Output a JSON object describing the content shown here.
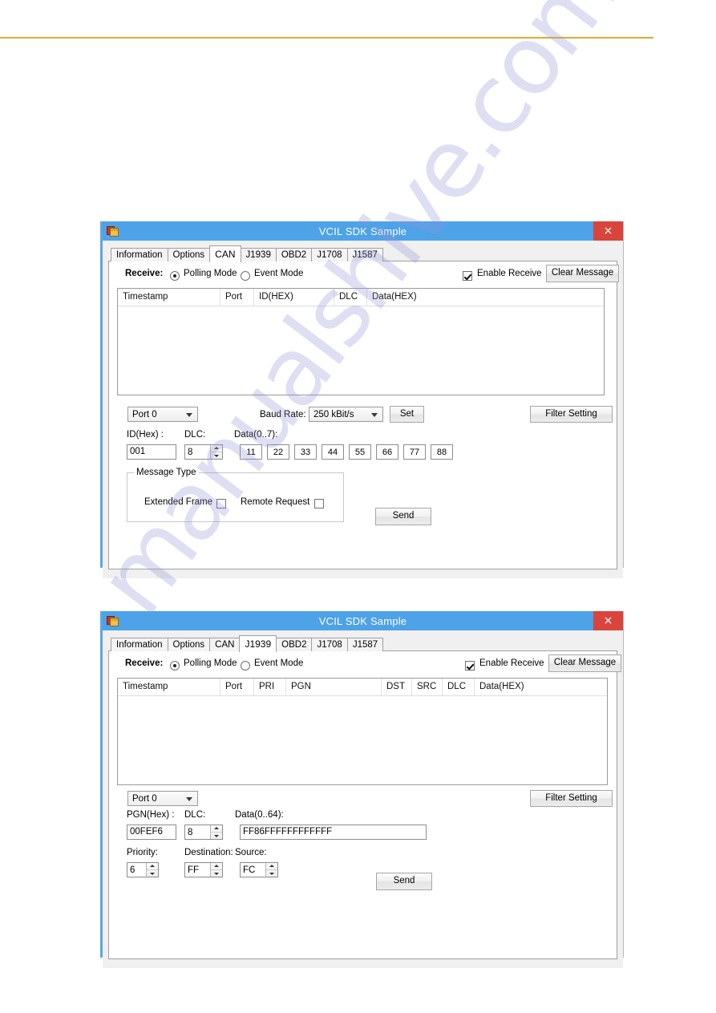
{
  "page": {
    "rule_color": "#d79a22",
    "watermark_text": "manualshive.com"
  },
  "windows": [
    {
      "id": "can",
      "title": "VCIL SDK Sample",
      "close_label": "×",
      "tabs": [
        {
          "label": "Information",
          "active": false
        },
        {
          "label": "Options",
          "active": false
        },
        {
          "label": "CAN",
          "active": true
        },
        {
          "label": "J1939",
          "active": false
        },
        {
          "label": "OBD2",
          "active": false
        },
        {
          "label": "J1708",
          "active": false
        },
        {
          "label": "J1587",
          "active": false
        }
      ],
      "receive": {
        "label": "Receive:",
        "polling_label": "Polling Mode",
        "polling_selected": true,
        "event_label": "Event Mode",
        "event_selected": false,
        "enable_receive_label": "Enable Receive",
        "enable_receive_checked": true,
        "clear_message_label": "Clear Message"
      },
      "list": {
        "columns": [
          "Timestamp",
          "Port",
          "ID(HEX)",
          "DLC",
          "Data(HEX)"
        ],
        "rows": []
      },
      "controls": {
        "port_value": "Port 0",
        "baud_label": "Baud Rate:",
        "baud_value": "250 kBit/s",
        "set_label": "Set",
        "filter_label": "Filter Setting",
        "id_label": "ID(Hex) :",
        "id_value": "001",
        "dlc_label": "DLC:",
        "dlc_value": "8",
        "data_label": "Data(0..7):",
        "data_values": [
          "11",
          "22",
          "33",
          "44",
          "55",
          "66",
          "77",
          "88"
        ],
        "msgtype_label": "Message Type",
        "extended_frame_label": "Extended Frame",
        "extended_frame_checked": false,
        "remote_request_label": "Remote Request",
        "remote_request_checked": false,
        "send_label": "Send"
      }
    },
    {
      "id": "j1939",
      "title": "VCIL SDK Sample",
      "close_label": "×",
      "tabs": [
        {
          "label": "Information",
          "active": false
        },
        {
          "label": "Options",
          "active": false
        },
        {
          "label": "CAN",
          "active": false
        },
        {
          "label": "J1939",
          "active": true
        },
        {
          "label": "OBD2",
          "active": false
        },
        {
          "label": "J1708",
          "active": false
        },
        {
          "label": "J1587",
          "active": false
        }
      ],
      "receive": {
        "label": "Receive:",
        "polling_label": "Polling Mode",
        "polling_selected": true,
        "event_label": "Event Mode",
        "event_selected": false,
        "enable_receive_label": "Enable Receive",
        "enable_receive_checked": true,
        "clear_message_label": "Clear Message"
      },
      "list": {
        "columns": [
          "Timestamp",
          "Port",
          "PRI",
          "PGN",
          "DST",
          "SRC",
          "DLC",
          "Data(HEX)"
        ],
        "rows": []
      },
      "controls": {
        "port_value": "Port 0",
        "filter_label": "Filter Setting",
        "pgn_label": "PGN(Hex) :",
        "pgn_value": "00FEF6",
        "dlc_label": "DLC:",
        "dlc_value": "8",
        "data_label": "Data(0..64):",
        "data_value": "FF86FFFFFFFFFFFF",
        "priority_label": "Priority:",
        "priority_value": "6",
        "destination_label": "Destination:",
        "destination_value": "FF",
        "source_label": "Source:",
        "source_value": "FC",
        "send_label": "Send"
      }
    }
  ]
}
